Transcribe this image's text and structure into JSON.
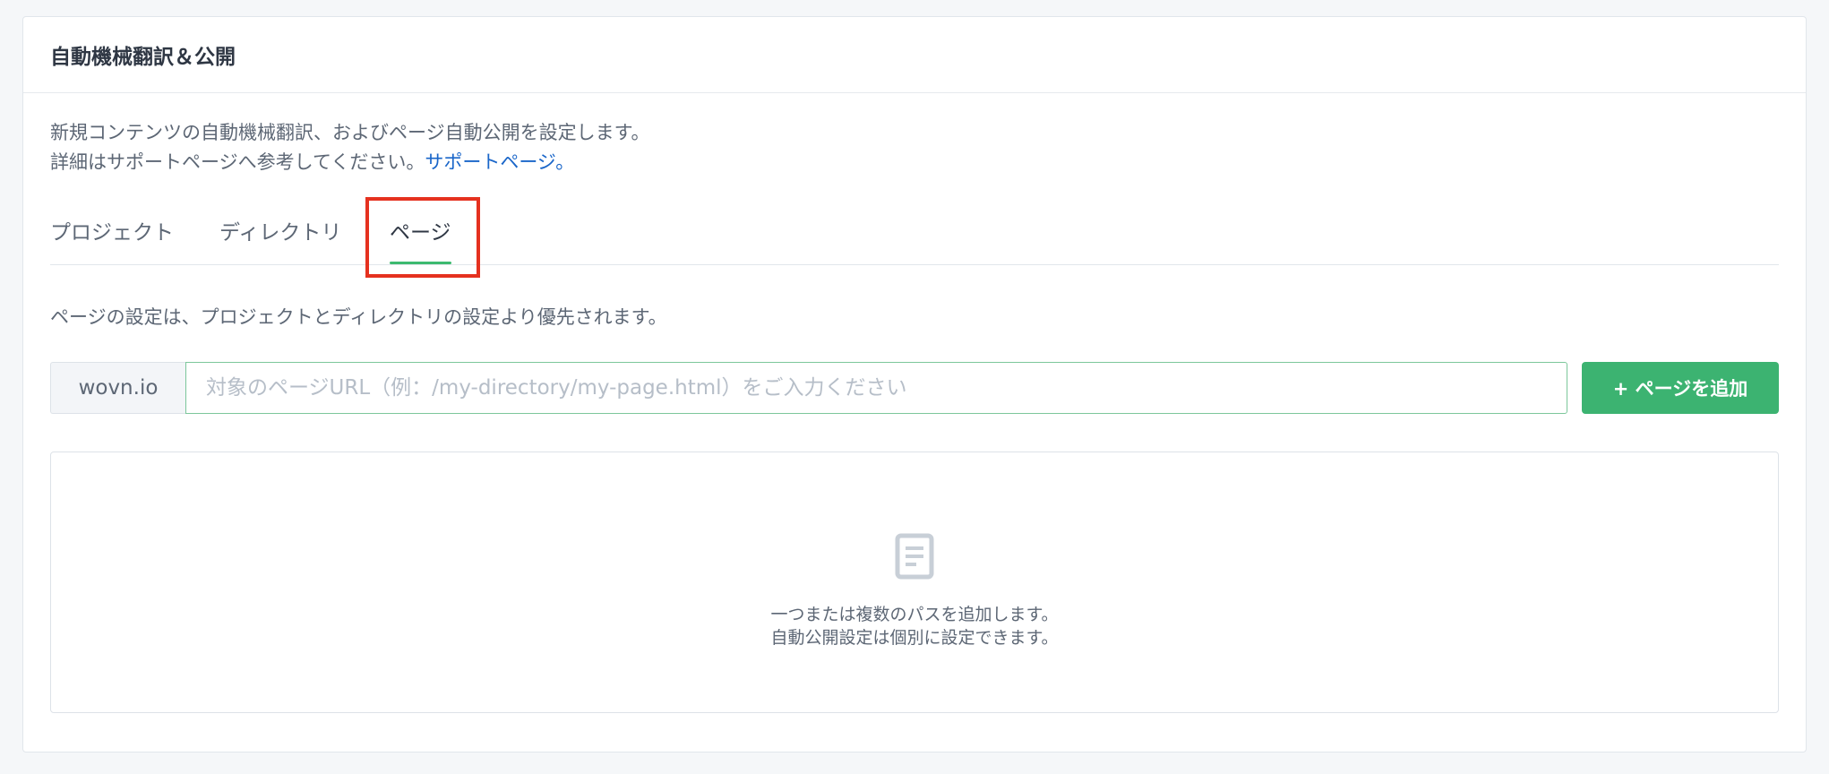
{
  "card": {
    "title": "自動機械翻訳＆公開"
  },
  "description": {
    "line1": "新規コンテンツの自動機械翻訳、およびページ自動公開を設定します。",
    "line2": "詳細はサポートページへ参考してください。",
    "support_link": "サポートページ。"
  },
  "tabs": [
    {
      "label": "プロジェクト",
      "active": false
    },
    {
      "label": "ディレクトリ",
      "active": false
    },
    {
      "label": "ページ",
      "active": true
    }
  ],
  "note": "ページの設定は、プロジェクトとディレクトリの設定より優先されます。",
  "url_form": {
    "prefix": "wovn.io",
    "value": "",
    "placeholder": "対象のページURL（例：/my-directory/my-page.html）をご入力ください",
    "add_button": "+ ページを追加"
  },
  "empty_state": {
    "icon": "document-icon",
    "line1": "一つまたは複数のパスを追加します。",
    "line2": "自動公開設定は個別に設定できます。"
  },
  "colors": {
    "accent_green": "#3cb371",
    "link_blue": "#1a66c9",
    "highlight_red": "#e5311f"
  }
}
